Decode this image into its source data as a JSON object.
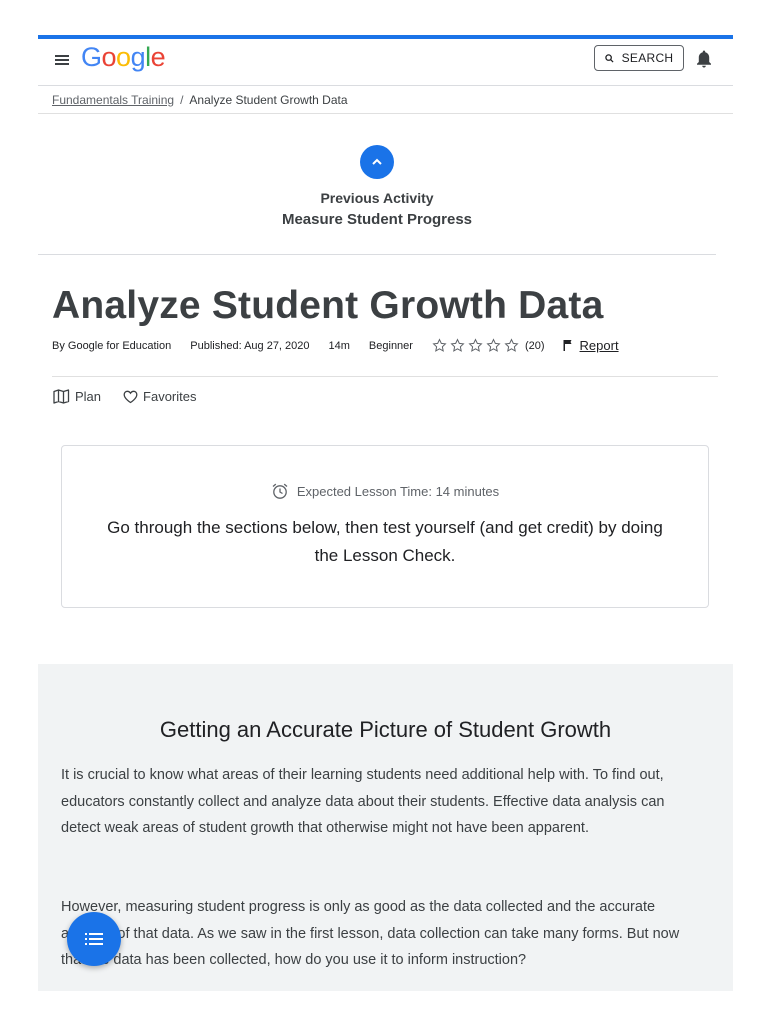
{
  "header": {
    "logo_text": "Google",
    "search_label": "SEARCH"
  },
  "breadcrumb": {
    "parent": "Fundamentals Training",
    "current": "Analyze Student Growth Data"
  },
  "previous": {
    "label": "Previous Activity",
    "title": "Measure Student Progress"
  },
  "lesson": {
    "title": "Analyze Student Growth Data",
    "author": "By Google for Education",
    "published": "Published: Aug 27, 2020",
    "duration": "14m",
    "level": "Beginner",
    "rating_count": "(20)",
    "report_label": "Report"
  },
  "actions": {
    "plan": "Plan",
    "favorites": "Favorites"
  },
  "card": {
    "expected_time": "Expected Lesson Time: 14 minutes",
    "text": "Go through the sections below, then test yourself (and get credit) by doing the Lesson Check."
  },
  "section": {
    "heading": "Getting an Accurate Picture of Student Growth",
    "paragraph1": "It is crucial to know what areas of their learning students need additional help with. To find out, educators constantly collect and analyze data about their students. Effective data analysis can detect weak areas of student growth that otherwise might not have been apparent.",
    "paragraph2": "However, measuring student progress is only as good as the data collected and the accurate analysis of that data. As we saw in the first lesson, data collection can take many forms. But now that the data has been collected, how do you use it to inform instruction?"
  },
  "colors": {
    "accent": "#1a73e8"
  }
}
